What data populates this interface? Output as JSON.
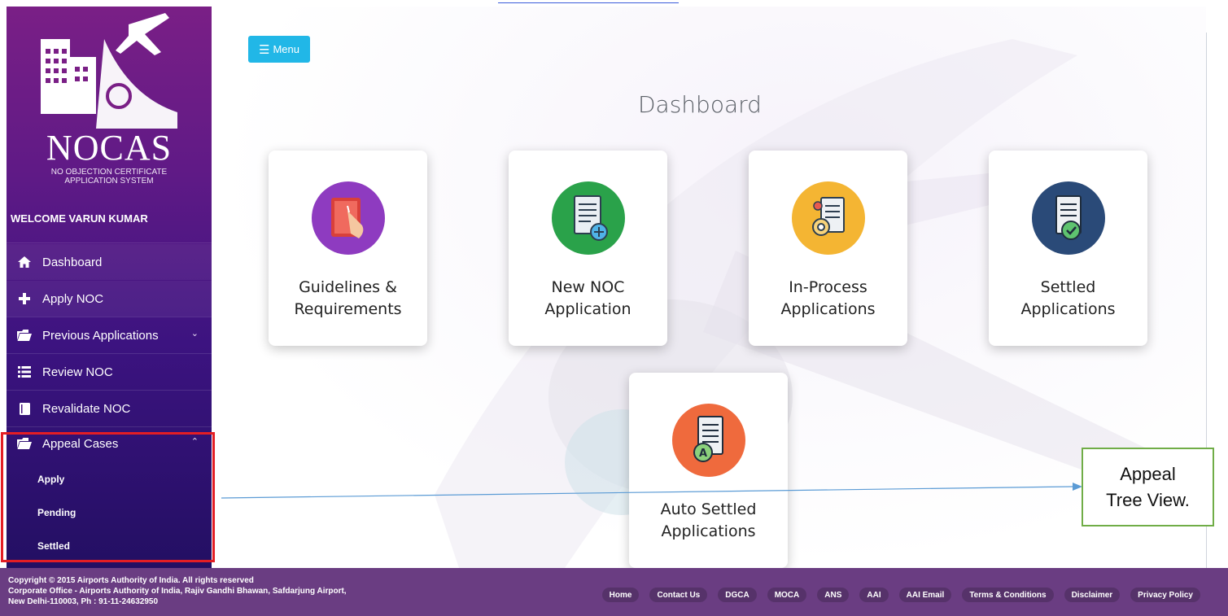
{
  "app": {
    "logo_text": "NOCAS",
    "logo_sub_line1": "NO OBJECTION CERTIFICATE",
    "logo_sub_line2": "APPLICATION SYSTEM",
    "welcome": "WELCOME VARUN KUMAR"
  },
  "sidebar": {
    "items": [
      {
        "label": "Dashboard",
        "icon": "home-icon"
      },
      {
        "label": "Apply NOC",
        "icon": "plus-icon"
      },
      {
        "label": "Previous Applications",
        "icon": "folder-open-icon"
      },
      {
        "label": "Review NOC",
        "icon": "list-icon"
      },
      {
        "label": "Revalidate NOC",
        "icon": "book-icon"
      },
      {
        "label": "Appeal Cases",
        "icon": "folder-open-icon"
      }
    ],
    "appeal_subitems": [
      "Apply",
      "Pending",
      "Settled"
    ]
  },
  "header": {
    "menu_label": "Menu"
  },
  "main": {
    "title": "Dashboard",
    "cards": [
      {
        "line1": "Guidelines &",
        "line2": "Requirements",
        "icon": "hand-book-icon",
        "color": "#8e3bc0"
      },
      {
        "line1": "New NOC",
        "line2": "Application",
        "icon": "document-add-icon",
        "color": "#2aa24a"
      },
      {
        "line1": "In-Process",
        "line2": "Applications",
        "icon": "document-gear-icon",
        "color": "#f4b533"
      },
      {
        "line1": "Settled",
        "line2": "Applications",
        "icon": "document-check-icon",
        "color": "#2a4a78"
      },
      {
        "line1": "Auto Settled",
        "line2": "Applications",
        "icon": "document-a-icon",
        "color": "#ef6a3d"
      }
    ]
  },
  "footer": {
    "line1": "Copyright © 2015 Airports Authority of India. All rights reserved",
    "line2": "Corporate Office - Airports Authority of India, Rajiv Gandhi Bhawan, Safdarjung Airport,",
    "line3": "New Delhi-110003, Ph : 91-11-24632950",
    "links": [
      "Home",
      "Contact Us",
      "DGCA",
      "MOCA",
      "ANS",
      "AAI",
      "AAI Email",
      "Terms & Conditions",
      "Disclaimer",
      "Privacy Policy"
    ]
  },
  "annotation": {
    "line1": "Appeal",
    "line2": "Tree View."
  },
  "colors": {
    "sidebar_top": "#7a1f86",
    "sidebar_bottom": "#230f63",
    "menu_button": "#21b7e7",
    "footer": "#6a3d82",
    "highlight": "#e31e24",
    "callout_border": "#70ad47",
    "arrow": "#5b9bd5"
  }
}
